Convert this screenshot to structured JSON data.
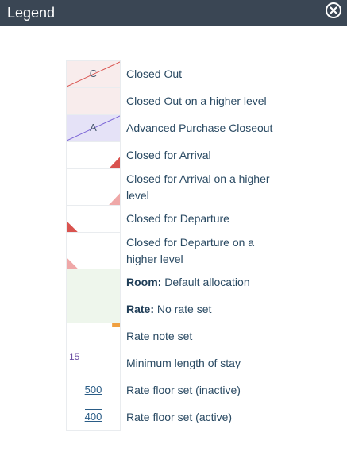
{
  "dialog": {
    "title": "Legend",
    "close_icon": "close-circle-icon"
  },
  "legend": [
    {
      "swatch": "closed-out",
      "swatch_text": "C",
      "label": "Closed Out"
    },
    {
      "swatch": "closed-out-higher",
      "label": "Closed Out on a higher level"
    },
    {
      "swatch": "advanced-purchase",
      "swatch_text": "A",
      "label": "Advanced Purchase Closeout"
    },
    {
      "swatch": "closed-arrival",
      "label": "Closed for Arrival"
    },
    {
      "swatch": "closed-arrival-higher",
      "label": "Closed for Arrival on a higher level"
    },
    {
      "swatch": "closed-departure",
      "label": "Closed for Departure"
    },
    {
      "swatch": "closed-departure-higher",
      "label": "Closed for Departure on a higher level"
    },
    {
      "swatch": "room-default",
      "label_bold": "Room:",
      "label": " Default allocation"
    },
    {
      "swatch": "rate-none",
      "label_bold": "Rate:",
      "label": " No rate set"
    },
    {
      "swatch": "rate-note",
      "label": "Rate note set"
    },
    {
      "swatch": "min-stay",
      "swatch_text": "15",
      "label": "Minimum length of stay"
    },
    {
      "swatch": "rate-floor-inactive",
      "swatch_text": "500",
      "label": "Rate floor set (inactive)"
    },
    {
      "swatch": "rate-floor-active",
      "swatch_text": "400",
      "label": "Rate floor set (active)"
    }
  ],
  "colors": {
    "header_bg": "#3a4654",
    "closed_red": "#d9534f",
    "closed_pink": "#f8ecec",
    "advanced_lavender": "#e5e2f7",
    "advanced_line": "#7a63d6",
    "higher_level_pink": "#efa8a8",
    "green": "#eef6ec",
    "note_orange": "#f0a040",
    "text": "#2a4a63"
  }
}
